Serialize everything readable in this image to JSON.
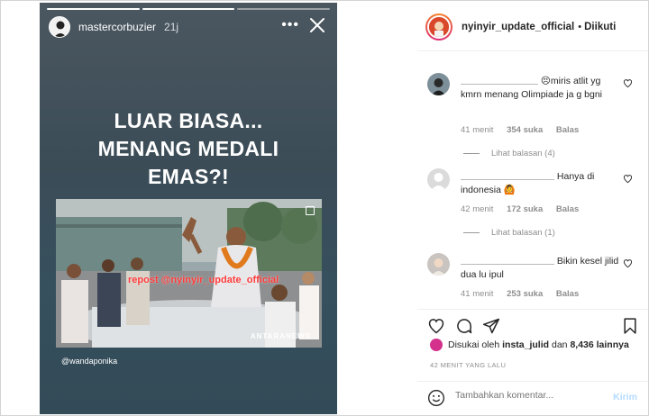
{
  "story": {
    "username": "mastercorbuzier",
    "time": "21j",
    "more": "•••",
    "headline_lines": [
      "LUAR BIASA...",
      "MENANG MEDALI",
      "EMAS?!"
    ],
    "watermark": "repost @nyinyir_update_official",
    "photo_source": "ANTARANEWS",
    "credit": "@wandaponika"
  },
  "post": {
    "username": "nyinyir_update_official",
    "separator": "•",
    "follow_status": "Diikuti"
  },
  "comments": [
    {
      "text": "😣miris atlit yg kmrn menang Olimpiade ja g bgni",
      "time": "41 menit",
      "likes": "354 suka",
      "reply": "Balas",
      "view_replies": "Lihat balasan (4)"
    },
    {
      "text": "Hanya di indonesia 🙆",
      "time": "42 menit",
      "likes": "172 suka",
      "reply": "Balas",
      "view_replies": "Lihat balasan (1)"
    },
    {
      "text": "Bikin kesel jilid dua lu ipul",
      "time": "41 menit",
      "likes": "253 suka",
      "reply": "Balas"
    }
  ],
  "likes_line": {
    "prefix": "Disukai oleh",
    "user": "insta_julid",
    "conj": "dan",
    "count": "8,436 lainnya"
  },
  "time_ago": "42 MENIT YANG LALU",
  "comment_box": {
    "placeholder": "Tambahkan komentar...",
    "post_label": "Kirim"
  },
  "icons": [
    "close-icon",
    "heart-icon",
    "comment-icon",
    "share-icon",
    "bookmark-icon",
    "emoji-icon"
  ],
  "colors": {
    "story_bg": "#3b4c57",
    "post_button": "#b3dbff",
    "watermark": "#ff3b3b"
  }
}
